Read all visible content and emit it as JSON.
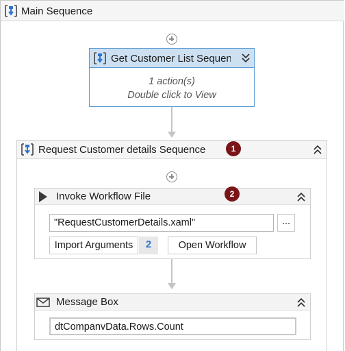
{
  "main_sequence": {
    "title": "Main Sequence"
  },
  "get_customer_list": {
    "title": "Get Customer List Sequenc",
    "actions_text": "1 action(s)",
    "hint_text": "Double click to View",
    "toggle_icon": "double-chevron-down-icon"
  },
  "request_customer_details": {
    "title": "Request Customer details Sequence",
    "badge": "1",
    "toggle_icon": "double-chevron-up-icon"
  },
  "invoke_workflow": {
    "title": "Invoke Workflow File",
    "badge": "2",
    "file_value": "\"RequestCustomerDetails.xaml\"",
    "browse_label": "...",
    "import_label": "Import Arguments",
    "import_count": "2",
    "open_label": "Open Workflow"
  },
  "message_box": {
    "title": "Message Box",
    "text_value": "dtCompanvData.Rows.Count"
  },
  "colors": {
    "accent": "#5a9bd5",
    "badge": "#7a1417",
    "count": "#2f6fd1"
  }
}
